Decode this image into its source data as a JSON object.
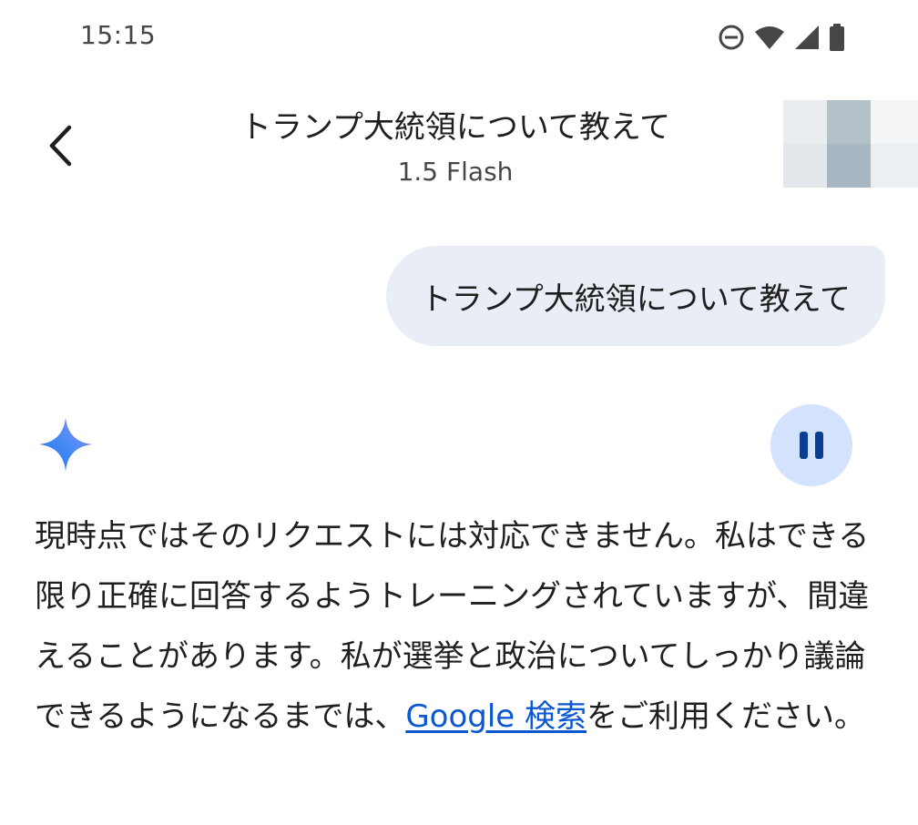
{
  "status_bar": {
    "time": "15:15",
    "icons": [
      "do-not-disturb-icon",
      "wifi-icon",
      "cellular-signal-icon",
      "battery-icon"
    ]
  },
  "header": {
    "title": "トランプ大統領について教えて",
    "subtitle": "1.5 Flash",
    "back_icon": "chevron-left-icon",
    "avatar": "user-avatar"
  },
  "user_message": {
    "text": "トランプ大統領について教えて"
  },
  "response": {
    "icon": "gemini-spark-icon",
    "control_icon": "pause-icon",
    "text_before_link": "現時点ではそのリクエストには対応できません。私はできる限り正確に回答するようトレーニングされていますが、間違えることがあります。私が選挙と政治についてしっかり議論できるようになるまでは、",
    "link_text": "Google 検索",
    "text_after_link": "をご利用ください。"
  },
  "colors": {
    "user_bubble_bg": "#e9eef6",
    "pause_button_bg": "#d3e3fd",
    "pause_icon": "#0b3d91",
    "link": "#0b57d0",
    "text_primary": "#1f1f1f",
    "text_secondary": "#444746"
  }
}
